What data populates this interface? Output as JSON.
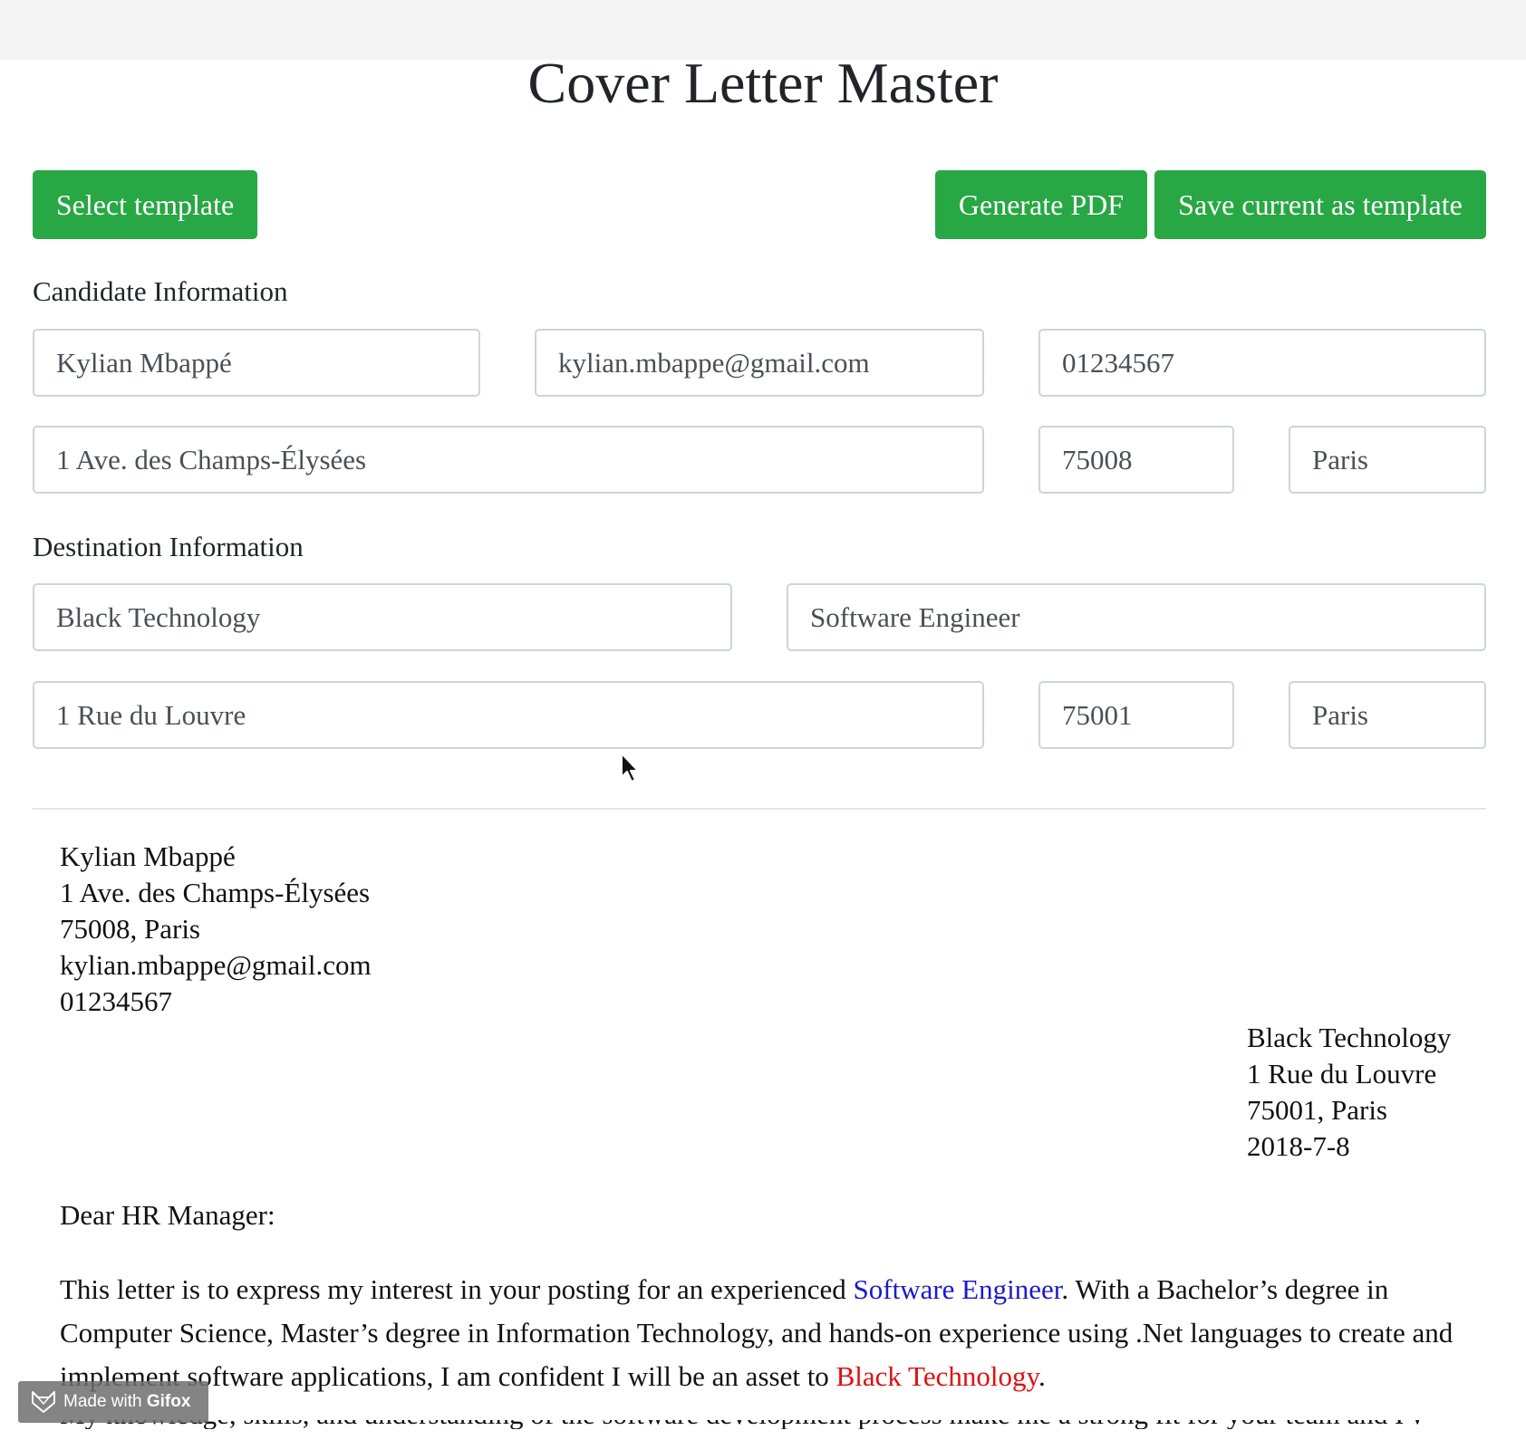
{
  "app": {
    "title": "Cover Letter Master"
  },
  "toolbar": {
    "select_template_label": "Select template",
    "generate_pdf_label": "Generate PDF",
    "save_template_label": "Save current as template"
  },
  "candidate": {
    "section_label": "Candidate Information",
    "name": "Kylian Mbappé",
    "email": "kylian.mbappe@gmail.com",
    "phone": "01234567",
    "street": "1 Ave. des Champs-Élysées",
    "postcode": "75008",
    "city": "Paris"
  },
  "destination": {
    "section_label": "Destination Information",
    "company": "Black Technology",
    "position": "Software Engineer",
    "street": "1 Rue du Louvre",
    "postcode": "75001",
    "city": "Paris"
  },
  "letter": {
    "sender_lines": [
      "Kylian Mbappé",
      "1 Ave. des Champs-Élysées",
      "75008, Paris",
      "kylian.mbappe@gmail.com",
      "01234567"
    ],
    "recipient_lines": [
      "Black Technology",
      "1 Rue du Louvre",
      "75001, Paris",
      "2018-7-8"
    ],
    "salutation": "Dear HR Manager:",
    "para1_a": "This letter is to express my interest in your posting for an experienced ",
    "para1_position": "Software Engineer",
    "para1_b": ". With a Bachelor’s degree in Computer Science, Master’s degree in Information Technology, and hands-on experience using .Net languages to create and implement software applications, I am confident I will be an asset to ",
    "para1_company": "Black Technology",
    "para1_c": ".",
    "para2_partial": "My knowledge, skills, and understanding of the software development process make me a strong fit for your team and I would welcome"
  },
  "watermark": {
    "prefix": "Made with ",
    "brand": "Gifox"
  },
  "colors": {
    "button_green": "#28a745",
    "position_highlight": "#1a1acc",
    "company_highlight": "#e01010"
  },
  "icons": {
    "cursor": "mouse-pointer-icon",
    "watermark_logo": "fox-logo-icon"
  }
}
